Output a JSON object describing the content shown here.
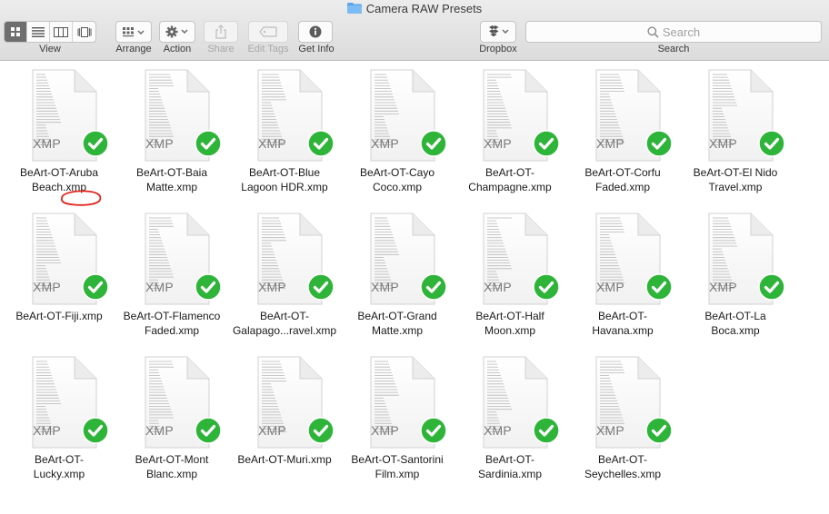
{
  "window": {
    "title": "Camera RAW Presets"
  },
  "toolbar": {
    "view_label": "View",
    "arrange_label": "Arrange",
    "action_label": "Action",
    "share_label": "Share",
    "edit_tags_label": "Edit Tags",
    "get_info_label": "Get Info",
    "dropbox_label": "Dropbox",
    "search_label": "Search",
    "search_placeholder": "Search",
    "view_modes": [
      "icon-view",
      "list-view",
      "column-view",
      "cover-flow-view"
    ],
    "active_view": "icon-view"
  },
  "files": [
    {
      "name": "BeArt-OT-Aruba\nBeach.xmp",
      "ext": "XMP",
      "synced": true,
      "annotated": true
    },
    {
      "name": "BeArt-OT-Baia\nMatte.xmp",
      "ext": "XMP",
      "synced": true
    },
    {
      "name": "BeArt-OT-Blue\nLagoon HDR.xmp",
      "ext": "XMP",
      "synced": true
    },
    {
      "name": "BeArt-OT-Cayo\nCoco.xmp",
      "ext": "XMP",
      "synced": true
    },
    {
      "name": "BeArt-OT-\nChampagne.xmp",
      "ext": "XMP",
      "synced": true
    },
    {
      "name": "BeArt-OT-Corfu\nFaded.xmp",
      "ext": "XMP",
      "synced": true
    },
    {
      "name": "BeArt-OT-El Nido\nTravel.xmp",
      "ext": "XMP",
      "synced": true
    },
    {
      "name": "BeArt-OT-Fiji.xmp",
      "ext": "XMP",
      "synced": true
    },
    {
      "name": "BeArt-OT-Flamenco\nFaded.xmp",
      "ext": "XMP",
      "synced": true
    },
    {
      "name": "BeArt-OT-\nGalapago...ravel.xmp",
      "ext": "XMP",
      "synced": true
    },
    {
      "name": "BeArt-OT-Grand\nMatte.xmp",
      "ext": "XMP",
      "synced": true
    },
    {
      "name": "BeArt-OT-Half\nMoon.xmp",
      "ext": "XMP",
      "synced": true
    },
    {
      "name": "BeArt-OT-\nHavana.xmp",
      "ext": "XMP",
      "synced": true
    },
    {
      "name": "BeArt-OT-La\nBoca.xmp",
      "ext": "XMP",
      "synced": true
    },
    {
      "name": "BeArt-OT-\nLucky.xmp",
      "ext": "XMP",
      "synced": true
    },
    {
      "name": "BeArt-OT-Mont\nBlanc.xmp",
      "ext": "XMP",
      "synced": true
    },
    {
      "name": "BeArt-OT-Muri.xmp",
      "ext": "XMP",
      "synced": true
    },
    {
      "name": "BeArt-OT-Santorini\nFilm.xmp",
      "ext": "XMP",
      "synced": true
    },
    {
      "name": "BeArt-OT-\nSardinia.xmp",
      "ext": "XMP",
      "synced": true
    },
    {
      "name": "BeArt-OT-\nSeychelles.xmp",
      "ext": "XMP",
      "synced": true
    }
  ],
  "colors": {
    "sync_check": "#2fb43a",
    "annotation": "#e0251b",
    "folder": "#5aa5e8"
  }
}
